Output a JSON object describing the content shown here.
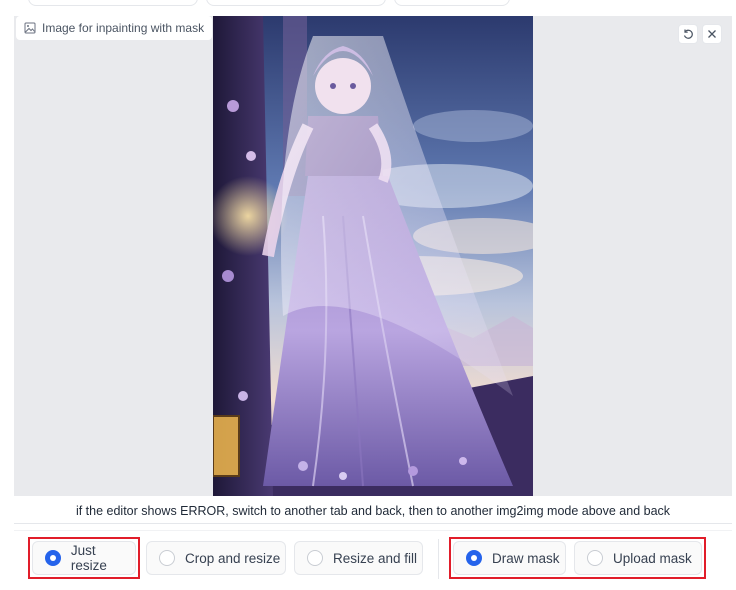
{
  "image_panel": {
    "label": "Image for inpainting with mask",
    "undo_icon": "undo-icon",
    "close_icon": "close-icon"
  },
  "hint_text": "if the editor shows ERROR, switch to another tab and back, then to another img2img mode above and back",
  "resize_mode": {
    "options": [
      "Just resize",
      "Crop and resize",
      "Resize and fill"
    ],
    "selected": "Just resize"
  },
  "mask_mode": {
    "options": [
      "Draw mask",
      "Upload mask"
    ],
    "selected": "Draw mask"
  },
  "colors": {
    "accent": "#2563eb",
    "highlight": "#e11d2a",
    "panel_bg": "#e9eaed"
  }
}
